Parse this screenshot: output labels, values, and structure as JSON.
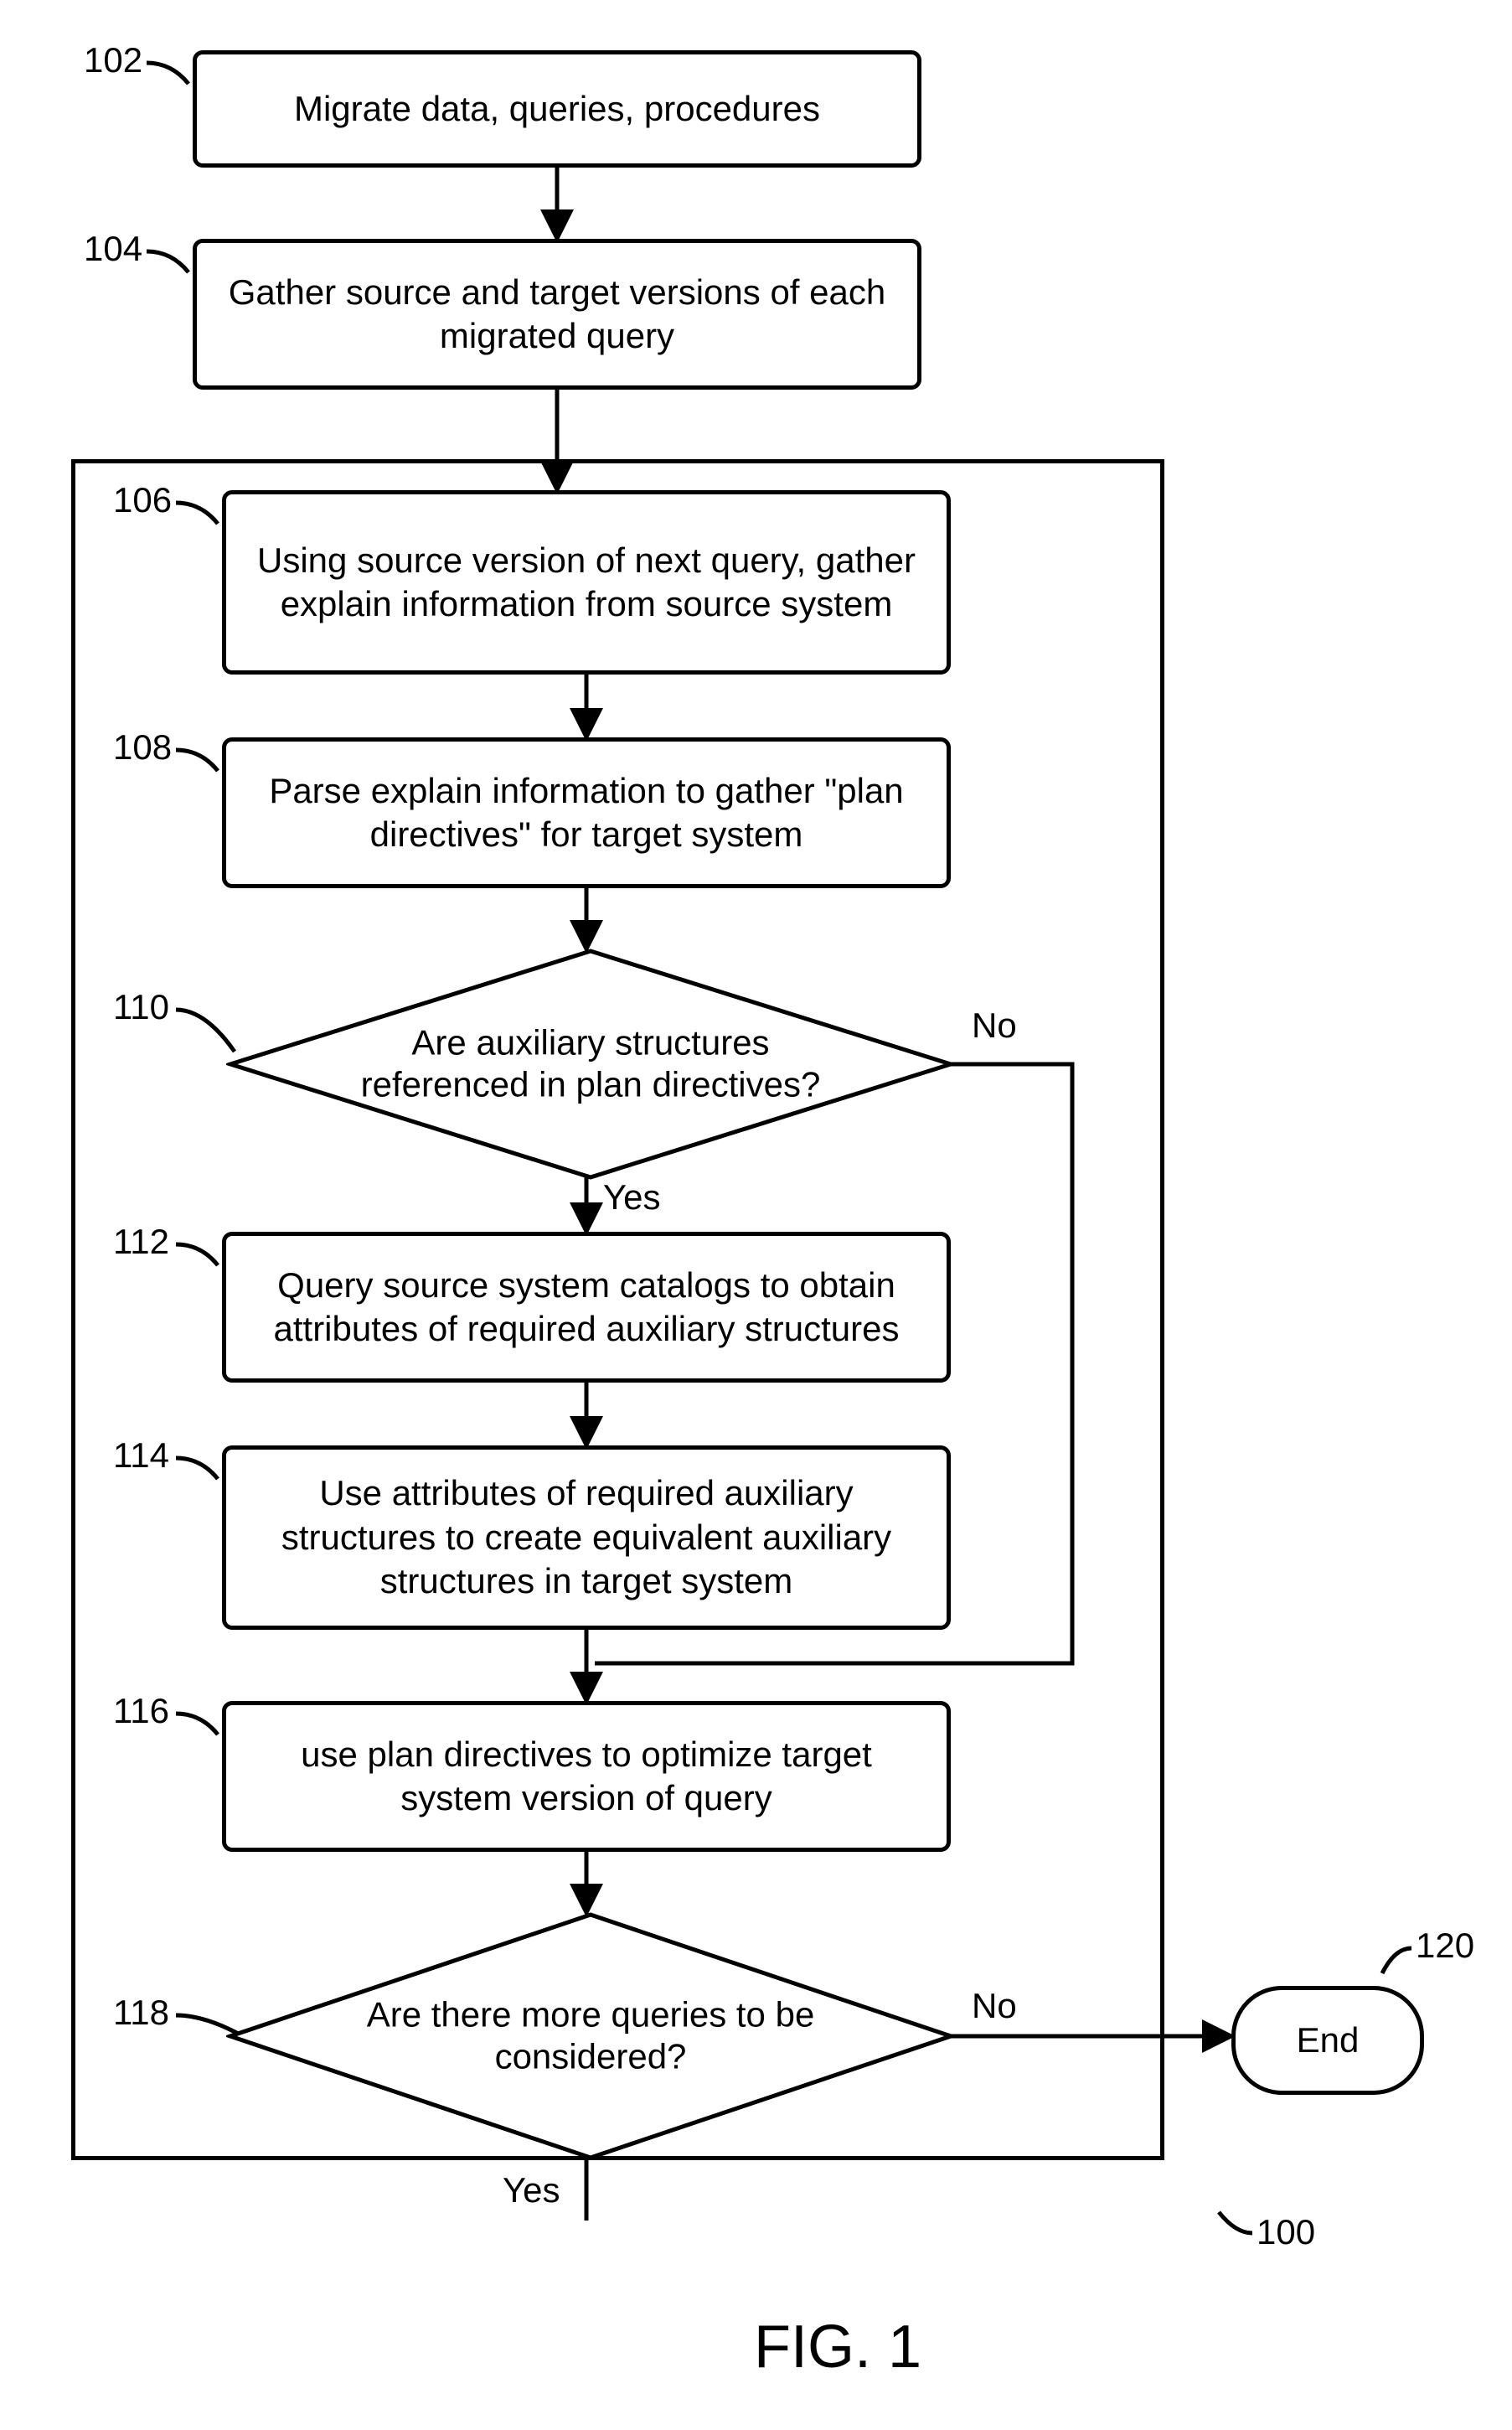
{
  "labels": {
    "n102": "102",
    "n104": "104",
    "n106": "106",
    "n108": "108",
    "n110": "110",
    "n112": "112",
    "n114": "114",
    "n116": "116",
    "n118": "118",
    "n120": "120",
    "n100": "100"
  },
  "boxes": {
    "b102": "Migrate data, queries, procedures",
    "b104": "Gather source and target versions of each migrated query",
    "b106": "Using source version of next query, gather explain information from source system",
    "b108": "Parse explain information to gather \"plan directives\" for target system",
    "b110": "Are auxiliary structures referenced in plan directives?",
    "b112": "Query source system catalogs to obtain attributes of required auxiliary structures",
    "b114": "Use attributes of required auxiliary structures to create equivalent auxiliary structures in target system",
    "b116": "use plan directives to optimize target system version of query",
    "b118": "Are there more queries to be considered?",
    "end": "End"
  },
  "edges": {
    "yes": "Yes",
    "no": "No"
  },
  "figure": "FIG. 1"
}
